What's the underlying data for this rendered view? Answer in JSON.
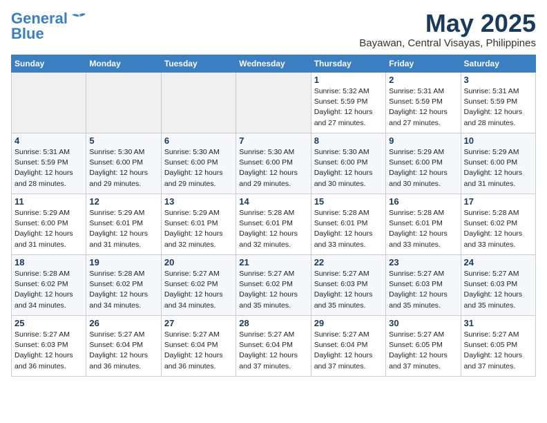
{
  "header": {
    "logo_general": "General",
    "logo_blue": "Blue",
    "month": "May 2025",
    "location": "Bayawan, Central Visayas, Philippines"
  },
  "days_of_week": [
    "Sunday",
    "Monday",
    "Tuesday",
    "Wednesday",
    "Thursday",
    "Friday",
    "Saturday"
  ],
  "weeks": [
    [
      {
        "day": "",
        "info": ""
      },
      {
        "day": "",
        "info": ""
      },
      {
        "day": "",
        "info": ""
      },
      {
        "day": "",
        "info": ""
      },
      {
        "day": "1",
        "info": "Sunrise: 5:32 AM\nSunset: 5:59 PM\nDaylight: 12 hours\nand 27 minutes."
      },
      {
        "day": "2",
        "info": "Sunrise: 5:31 AM\nSunset: 5:59 PM\nDaylight: 12 hours\nand 27 minutes."
      },
      {
        "day": "3",
        "info": "Sunrise: 5:31 AM\nSunset: 5:59 PM\nDaylight: 12 hours\nand 28 minutes."
      }
    ],
    [
      {
        "day": "4",
        "info": "Sunrise: 5:31 AM\nSunset: 5:59 PM\nDaylight: 12 hours\nand 28 minutes."
      },
      {
        "day": "5",
        "info": "Sunrise: 5:30 AM\nSunset: 6:00 PM\nDaylight: 12 hours\nand 29 minutes."
      },
      {
        "day": "6",
        "info": "Sunrise: 5:30 AM\nSunset: 6:00 PM\nDaylight: 12 hours\nand 29 minutes."
      },
      {
        "day": "7",
        "info": "Sunrise: 5:30 AM\nSunset: 6:00 PM\nDaylight: 12 hours\nand 29 minutes."
      },
      {
        "day": "8",
        "info": "Sunrise: 5:30 AM\nSunset: 6:00 PM\nDaylight: 12 hours\nand 30 minutes."
      },
      {
        "day": "9",
        "info": "Sunrise: 5:29 AM\nSunset: 6:00 PM\nDaylight: 12 hours\nand 30 minutes."
      },
      {
        "day": "10",
        "info": "Sunrise: 5:29 AM\nSunset: 6:00 PM\nDaylight: 12 hours\nand 31 minutes."
      }
    ],
    [
      {
        "day": "11",
        "info": "Sunrise: 5:29 AM\nSunset: 6:00 PM\nDaylight: 12 hours\nand 31 minutes."
      },
      {
        "day": "12",
        "info": "Sunrise: 5:29 AM\nSunset: 6:01 PM\nDaylight: 12 hours\nand 31 minutes."
      },
      {
        "day": "13",
        "info": "Sunrise: 5:29 AM\nSunset: 6:01 PM\nDaylight: 12 hours\nand 32 minutes."
      },
      {
        "day": "14",
        "info": "Sunrise: 5:28 AM\nSunset: 6:01 PM\nDaylight: 12 hours\nand 32 minutes."
      },
      {
        "day": "15",
        "info": "Sunrise: 5:28 AM\nSunset: 6:01 PM\nDaylight: 12 hours\nand 33 minutes."
      },
      {
        "day": "16",
        "info": "Sunrise: 5:28 AM\nSunset: 6:01 PM\nDaylight: 12 hours\nand 33 minutes."
      },
      {
        "day": "17",
        "info": "Sunrise: 5:28 AM\nSunset: 6:02 PM\nDaylight: 12 hours\nand 33 minutes."
      }
    ],
    [
      {
        "day": "18",
        "info": "Sunrise: 5:28 AM\nSunset: 6:02 PM\nDaylight: 12 hours\nand 34 minutes."
      },
      {
        "day": "19",
        "info": "Sunrise: 5:28 AM\nSunset: 6:02 PM\nDaylight: 12 hours\nand 34 minutes."
      },
      {
        "day": "20",
        "info": "Sunrise: 5:27 AM\nSunset: 6:02 PM\nDaylight: 12 hours\nand 34 minutes."
      },
      {
        "day": "21",
        "info": "Sunrise: 5:27 AM\nSunset: 6:02 PM\nDaylight: 12 hours\nand 35 minutes."
      },
      {
        "day": "22",
        "info": "Sunrise: 5:27 AM\nSunset: 6:03 PM\nDaylight: 12 hours\nand 35 minutes."
      },
      {
        "day": "23",
        "info": "Sunrise: 5:27 AM\nSunset: 6:03 PM\nDaylight: 12 hours\nand 35 minutes."
      },
      {
        "day": "24",
        "info": "Sunrise: 5:27 AM\nSunset: 6:03 PM\nDaylight: 12 hours\nand 35 minutes."
      }
    ],
    [
      {
        "day": "25",
        "info": "Sunrise: 5:27 AM\nSunset: 6:03 PM\nDaylight: 12 hours\nand 36 minutes."
      },
      {
        "day": "26",
        "info": "Sunrise: 5:27 AM\nSunset: 6:04 PM\nDaylight: 12 hours\nand 36 minutes."
      },
      {
        "day": "27",
        "info": "Sunrise: 5:27 AM\nSunset: 6:04 PM\nDaylight: 12 hours\nand 36 minutes."
      },
      {
        "day": "28",
        "info": "Sunrise: 5:27 AM\nSunset: 6:04 PM\nDaylight: 12 hours\nand 37 minutes."
      },
      {
        "day": "29",
        "info": "Sunrise: 5:27 AM\nSunset: 6:04 PM\nDaylight: 12 hours\nand 37 minutes."
      },
      {
        "day": "30",
        "info": "Sunrise: 5:27 AM\nSunset: 6:05 PM\nDaylight: 12 hours\nand 37 minutes."
      },
      {
        "day": "31",
        "info": "Sunrise: 5:27 AM\nSunset: 6:05 PM\nDaylight: 12 hours\nand 37 minutes."
      }
    ]
  ]
}
